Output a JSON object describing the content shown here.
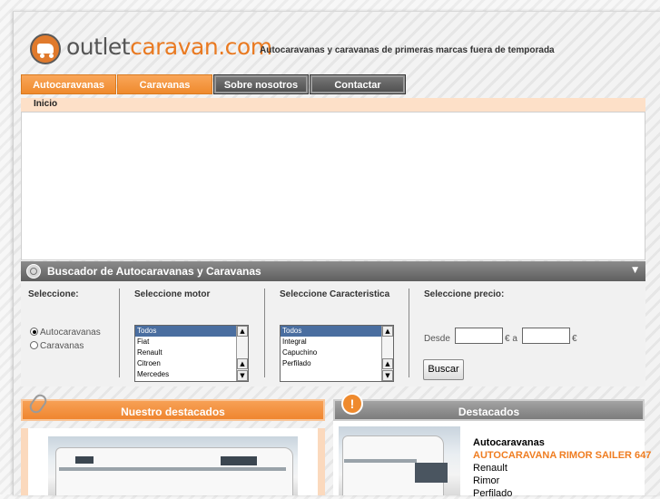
{
  "header": {
    "brand_part1": "outlet",
    "brand_part2": "caravan.com",
    "tagline": "Autocaravanas y caravanas de primeras marcas fuera de temporada"
  },
  "nav": {
    "tabs": [
      {
        "label": "Autocaravanas"
      },
      {
        "label": "Caravanas"
      },
      {
        "label": "Sobre nosotros"
      },
      {
        "label": "Contactar"
      }
    ],
    "breadcrumb": "Inicio"
  },
  "search": {
    "title": "Buscador de Autocaravanas y Caravanas",
    "col1_label": "Seleccione:",
    "radios": [
      {
        "label": "Autocaravanas",
        "checked": true
      },
      {
        "label": "Caravanas",
        "checked": false
      }
    ],
    "motor_label": "Seleccione motor",
    "motor_options": [
      "Todos",
      "Fiat",
      "Renault",
      "Citroen",
      "Mercedes"
    ],
    "motor_selected": "Todos",
    "caract_label": "Seleccione Caracteristica",
    "caract_options": [
      "Todos",
      "Integral",
      "Capuchino",
      "Perfilado"
    ],
    "caract_selected": "Todos",
    "price_label": "Seleccione precio:",
    "from_label": "Desde",
    "currency_to": "€ a",
    "currency_end": "€",
    "from_value": "",
    "to_value": "",
    "button": "Buscar"
  },
  "boxes": {
    "left_title": "Nuestro destacados",
    "right_title": "Destacados",
    "warn_glyph": "!",
    "featured": {
      "category": "Autocaravanas",
      "name": "AUTOCARAVANA RIMOR SAILER 647",
      "engine": "Renault",
      "brand": "Rimor",
      "type": "Perfilado"
    }
  },
  "colors": {
    "accent": "#ef8a2d",
    "grey_tab": "#5a5a5a",
    "link": "#ef7d21"
  }
}
